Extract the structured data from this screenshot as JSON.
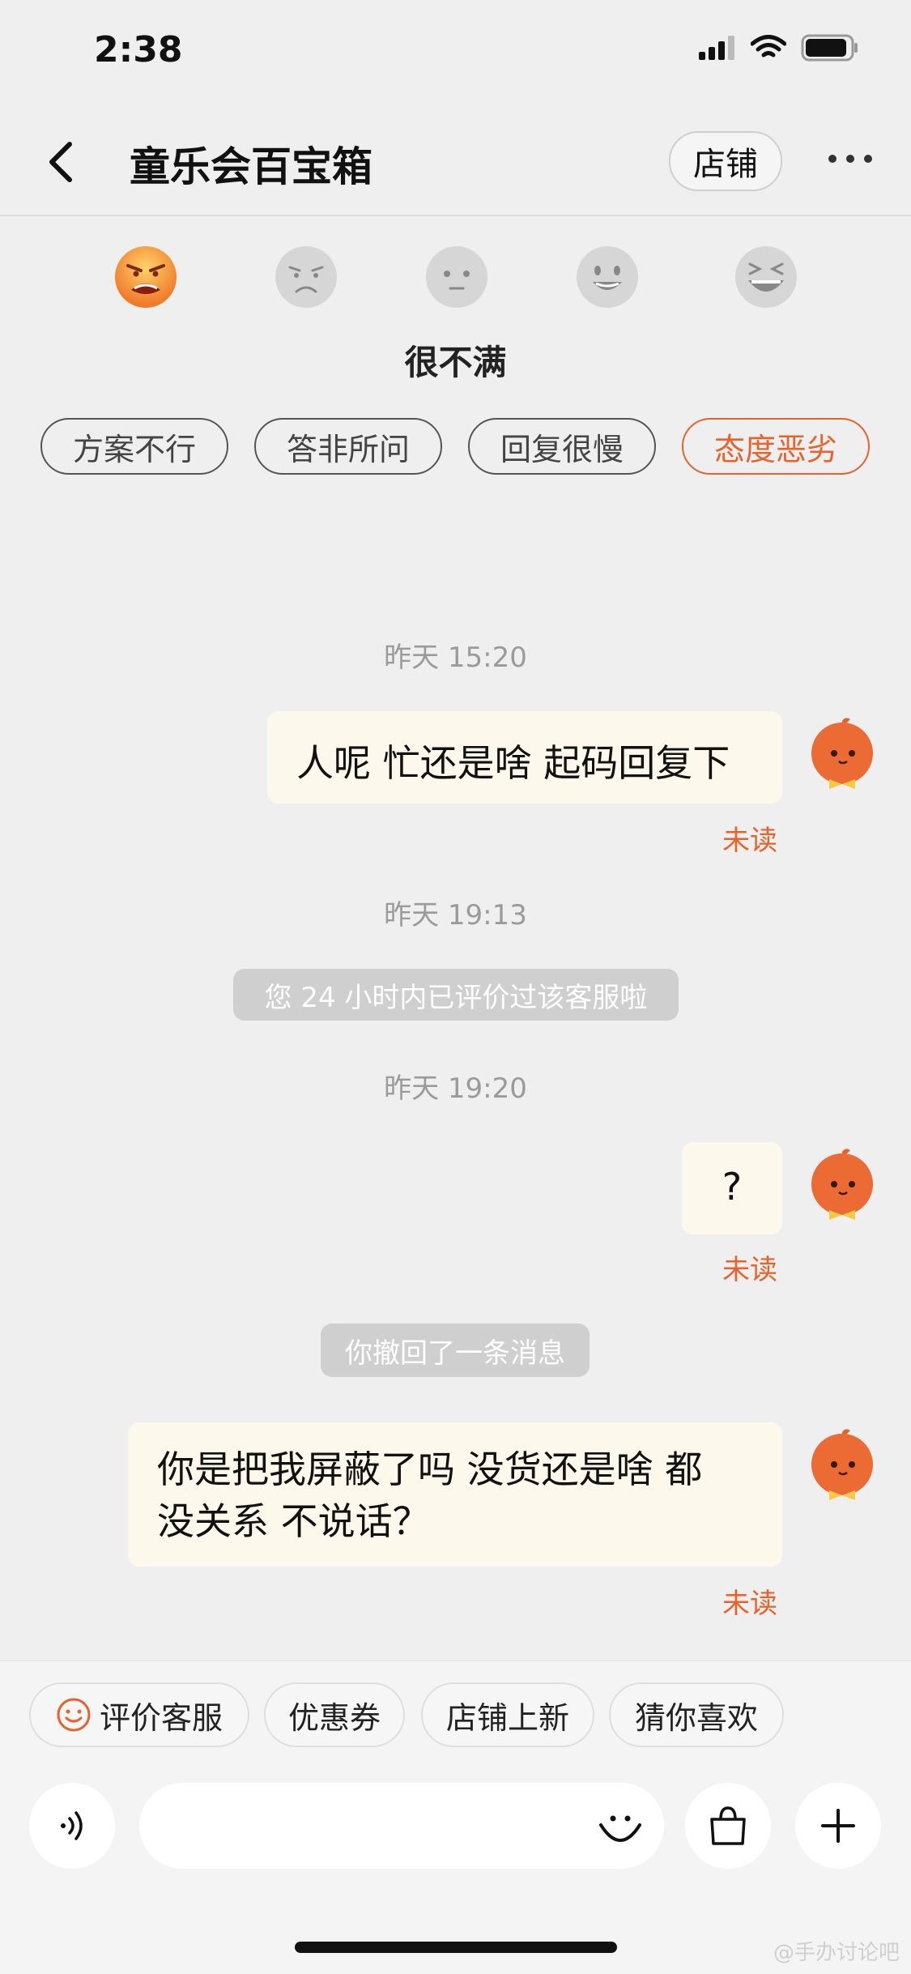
{
  "status": {
    "time": "2:38"
  },
  "header": {
    "title": "童乐会百宝箱",
    "shop_button": "店铺"
  },
  "rating": {
    "label": "很不满",
    "emojis": [
      "angry-face-icon",
      "frown-face-icon",
      "neutral-face-icon",
      "smile-face-icon",
      "laugh-face-icon"
    ],
    "tags": [
      "方案不行",
      "答非所问",
      "回复很慢",
      "态度恶劣"
    ],
    "active_tag": "态度恶劣"
  },
  "chat": {
    "time1": "昨天 15:20",
    "msg1": "人呢 忙还是啥 起码回复下",
    "time2": "昨天 19:13",
    "system1": "您 24 小时内已评价过该客服啦",
    "time3": "昨天 19:20",
    "msg2": "?",
    "system2": "你撤回了一条消息",
    "msg3_line1": "你是把我屏蔽了吗  没货还是啥 都",
    "msg3_line2": "没关系  不说话？",
    "unread_label": "未读"
  },
  "bottom": {
    "chips": [
      "评价客服",
      "优惠券",
      "店铺上新",
      "猜你喜欢"
    ]
  },
  "watermark": "@手办讨论吧",
  "colors": {
    "accent": "#e8622c",
    "bubble": "#fcf9ec",
    "background": "#efefef"
  }
}
